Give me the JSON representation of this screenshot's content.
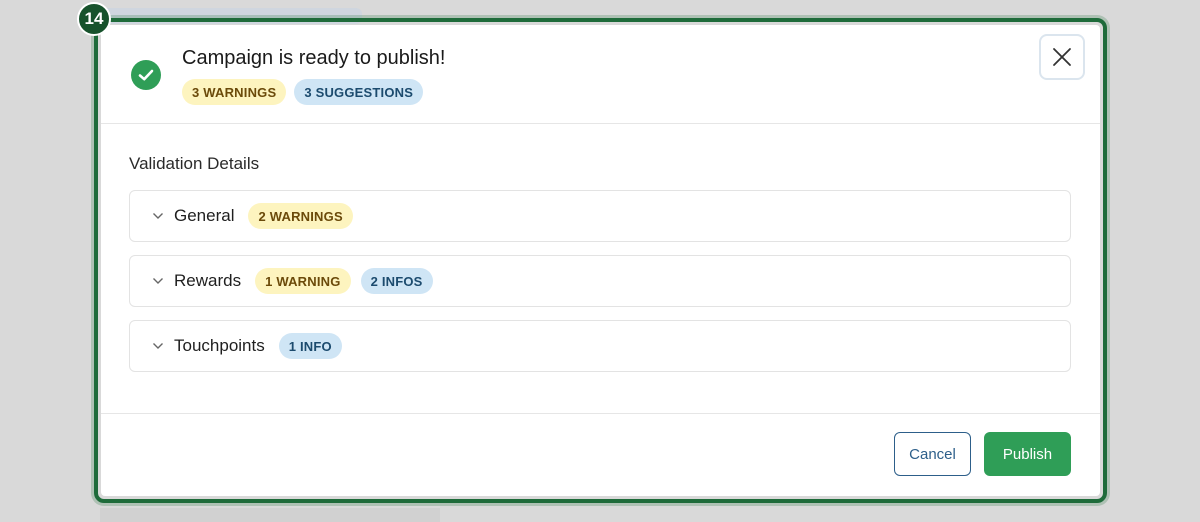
{
  "step": {
    "number": "14"
  },
  "header": {
    "title": "Campaign is ready to publish!",
    "badges": {
      "warnings": "3 WARNINGS",
      "suggestions": "3 SUGGESTIONS"
    }
  },
  "body": {
    "section_title": "Validation Details",
    "items": [
      {
        "label": "General",
        "badges": [
          "2 WARNINGS"
        ]
      },
      {
        "label": "Rewards",
        "badges": [
          "1 WARNING",
          "2 INFOS"
        ]
      },
      {
        "label": "Touchpoints",
        "badges": [
          "1 INFO"
        ]
      }
    ]
  },
  "footer": {
    "cancel_label": "Cancel",
    "publish_label": "Publish"
  },
  "colors": {
    "success": "#2f9e57",
    "warning_bg": "#fdf4bf",
    "info_bg": "#cfe5f5",
    "highlight": "#1e6b3a"
  },
  "icons": {
    "status": "check-circle-icon",
    "close": "close-icon",
    "expand": "chevron-down-icon"
  }
}
